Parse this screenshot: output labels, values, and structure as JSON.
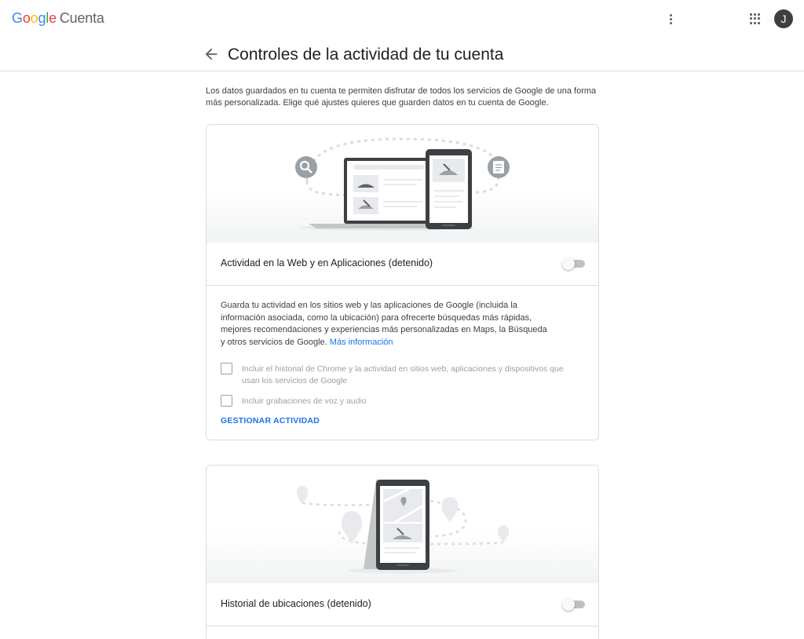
{
  "header": {
    "logo_letters": [
      "G",
      "o",
      "o",
      "g",
      "l",
      "e"
    ],
    "product": "Cuenta",
    "avatar_initial": "J"
  },
  "titlebar": {
    "title": "Controles de la actividad de tu cuenta"
  },
  "intro": "Los datos guardados en tu cuenta te permiten disfrutar de todos los servicios de Google de una forma más personalizada. Elige qué ajustes quieres que guarden datos en tu cuenta de Google.",
  "web_activity": {
    "label": "Actividad en la Web y en Aplicaciones (detenido)",
    "enabled": false,
    "description": "Guarda tu actividad en los sitios web y las aplicaciones de Google (incluida la información asociada, como la ubicación) para ofrecerte búsquedas más rápidas, mejores recomendaciones y experiencias más personalizadas en Maps, la Búsqueda y otros servicios de Google.",
    "more_info": "Más información",
    "options": [
      {
        "label": "Incluir el historial de Chrome y la actividad en sitios web, aplicaciones y dispositivos que usan los servicios de Google",
        "checked": false
      },
      {
        "label": "Incluir grabaciones de voz y audio",
        "checked": false
      }
    ],
    "manage": "GESTIONAR ACTIVIDAD"
  },
  "location_history": {
    "label": "Historial de ubicaciones (detenido)",
    "enabled": false
  },
  "colors": {
    "link": "#1a73e8",
    "toggle_off_track": "#bdc1c6",
    "divider": "#dadce0"
  }
}
